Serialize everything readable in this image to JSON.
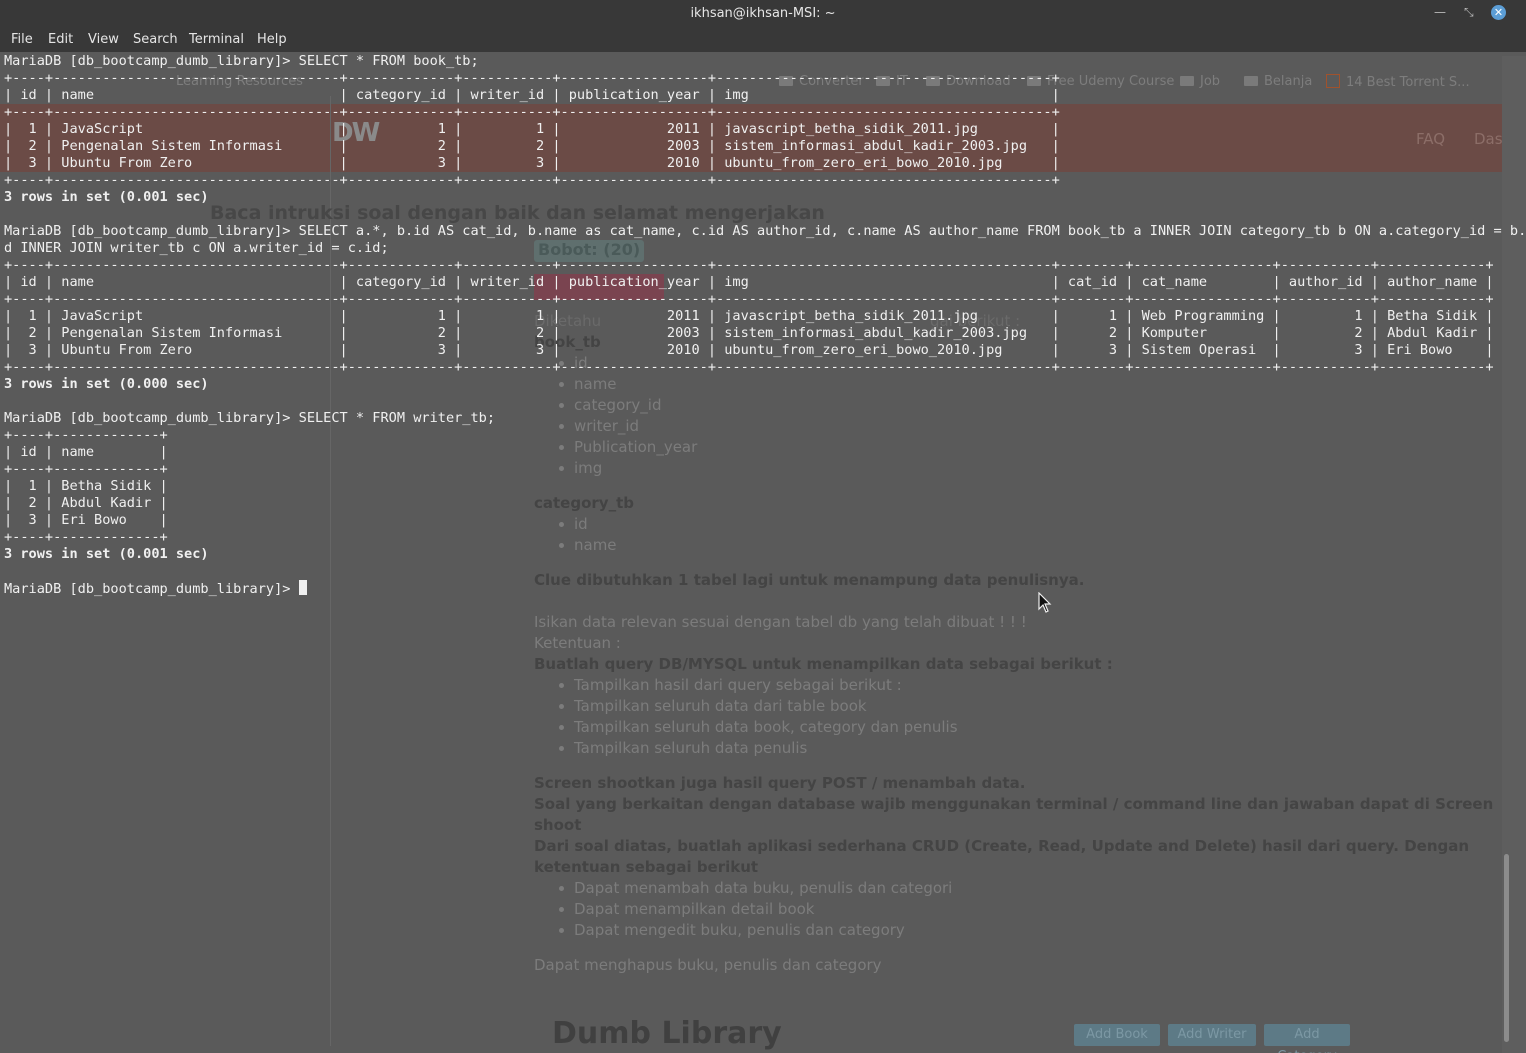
{
  "window": {
    "title": "ikhsan@ikhsan-MSI: ~"
  },
  "menu": [
    "File",
    "Edit",
    "View",
    "Search",
    "Terminal",
    "Help"
  ],
  "terminal": {
    "lines": [
      {
        "text": "MariaDB [db_bootcamp_dumb_library]> SELECT * FROM book_tb;",
        "bold": false
      },
      {
        "text": "+----+-----------------------------------+-------------+-----------+------------------+-----------------------------------------+",
        "bold": false
      },
      {
        "text": "| id | name                              | category_id | writer_id | publication_year | img                                     |",
        "bold": false
      },
      {
        "text": "+----+-----------------------------------+-------------+-----------+------------------+-----------------------------------------+",
        "bold": false
      },
      {
        "text": "|  1 | JavaScript                        |           1 |         1 |             2011 | javascript_betha_sidik_2011.jpg         |",
        "bold": false
      },
      {
        "text": "|  2 | Pengenalan Sistem Informasi       |           2 |         2 |             2003 | sistem_informasi_abdul_kadir_2003.jpg   |",
        "bold": false
      },
      {
        "text": "|  3 | Ubuntu From Zero                  |           3 |         3 |             2010 | ubuntu_from_zero_eri_bowo_2010.jpg      |",
        "bold": false
      },
      {
        "text": "+----+-----------------------------------+-------------+-----------+------------------+-----------------------------------------+",
        "bold": false
      },
      {
        "text": "3 rows in set (0.001 sec)",
        "bold": true
      },
      {
        "text": "",
        "bold": false
      },
      {
        "text": "MariaDB [db_bootcamp_dumb_library]> SELECT a.*, b.id AS cat_id, b.name as cat_name, c.id AS author_id, c.name AS author_name FROM book_tb a INNER JOIN category_tb b ON a.category_id = b.i",
        "bold": false
      },
      {
        "text": "d INNER JOIN writer_tb c ON a.writer_id = c.id;",
        "bold": false
      },
      {
        "text": "+----+-----------------------------------+-------------+-----------+------------------+-----------------------------------------+--------+-----------------+-----------+-------------+",
        "bold": false
      },
      {
        "text": "| id | name                              | category_id | writer_id | publication_year | img                                     | cat_id | cat_name        | author_id | author_name |",
        "bold": false
      },
      {
        "text": "+----+-----------------------------------+-------------+-----------+------------------+-----------------------------------------+--------+-----------------+-----------+-------------+",
        "bold": false
      },
      {
        "text": "|  1 | JavaScript                        |           1 |         1 |             2011 | javascript_betha_sidik_2011.jpg         |      1 | Web Programming |         1 | Betha Sidik |",
        "bold": false
      },
      {
        "text": "|  2 | Pengenalan Sistem Informasi       |           2 |         2 |             2003 | sistem_informasi_abdul_kadir_2003.jpg   |      2 | Komputer        |         2 | Abdul Kadir |",
        "bold": false
      },
      {
        "text": "|  3 | Ubuntu From Zero                  |           3 |         3 |             2010 | ubuntu_from_zero_eri_bowo_2010.jpg      |      3 | Sistem Operasi  |         3 | Eri Bowo    |",
        "bold": false
      },
      {
        "text": "+----+-----------------------------------+-------------+-----------+------------------+-----------------------------------------+--------+-----------------+-----------+-------------+",
        "bold": false
      },
      {
        "text": "3 rows in set (0.000 sec)",
        "bold": true
      },
      {
        "text": "",
        "bold": false
      },
      {
        "text": "MariaDB [db_bootcamp_dumb_library]> SELECT * FROM writer_tb;",
        "bold": false
      },
      {
        "text": "+----+-------------+",
        "bold": false
      },
      {
        "text": "| id | name        |",
        "bold": false
      },
      {
        "text": "+----+-------------+",
        "bold": false
      },
      {
        "text": "|  1 | Betha Sidik |",
        "bold": false
      },
      {
        "text": "|  2 | Abdul Kadir |",
        "bold": false
      },
      {
        "text": "|  3 | Eri Bowo    |",
        "bold": false
      },
      {
        "text": "+----+-------------+",
        "bold": false
      },
      {
        "text": "3 rows in set (0.001 sec)",
        "bold": true
      },
      {
        "text": "",
        "bold": false
      }
    ],
    "prompt": "MariaDB [db_bootcamp_dumb_library]> "
  },
  "background_page": {
    "bookmarks": [
      {
        "label": "Learning Resources",
        "icon": "folder-icon"
      },
      {
        "label": "Converter",
        "icon": "folder-icon"
      },
      {
        "label": "IT",
        "icon": "folder-icon"
      },
      {
        "label": "Download",
        "icon": "folder-icon"
      },
      {
        "label": "Free Udemy Course",
        "icon": "folder-icon"
      },
      {
        "label": "Job",
        "icon": "folder-icon"
      },
      {
        "label": "Belanja",
        "icon": "folder-icon"
      },
      {
        "label": "14 Best Torrent S...",
        "icon": "torrent-icon"
      }
    ],
    "nav": [
      "FAQ",
      "Das"
    ],
    "instruction_heading": "Baca intruksi soal dengan baik dan selamat mengerjakan",
    "bobot": "Bobot: (20)",
    "book_tb_title": "book_tb",
    "book_tb_fields": [
      "id",
      "name",
      "category_id",
      "writer_id",
      "Publication_year",
      "img"
    ],
    "diketahui_tail": "gai berikut :",
    "category_tb_title": "category_tb",
    "category_tb_fields": [
      "id",
      "name"
    ],
    "clue": "Clue dibutuhkan 1 tabel lagi untuk menampung data penulisnya.",
    "isikan": "Isikan data relevan sesuai dengan tabel db yang telah dibuat ! ! !",
    "ketentuan": "Ketentuan :",
    "buatlah": "Buatlah query DB/MYSQL untuk menampilkan data sebagai berikut :",
    "query_items": [
      "Tampilkan hasil dari query sebagai berikut :",
      "Tampilkan seluruh data dari table book",
      "Tampilkan seluruh data book, category dan penulis",
      "Tampilkan seluruh data penulis"
    ],
    "screenshoot_note": "Screen shootkan juga hasil query POST / menambah data.",
    "soal_line1": "Soal yang berkaitan dengan database wajib menggunakan terminal / command line dan jawaban dapat di Screen",
    "soal_line2": "shoot",
    "crud_line1": "Dari soal diatas, buatlah aplikasi sederhana CRUD (Create, Read, Update and Delete) hasil dari query. Dengan",
    "crud_line2": "ketentuan sebagai berikut",
    "crud_items": [
      "Dapat menambah data buku, penulis dan categori",
      "Dapat menampilkan detail book",
      "Dapat mengedit buku, penulis dan category"
    ],
    "hapus": "Dapat menghapus buku, penulis dan category",
    "app_title": "Dumb Library",
    "buttons": [
      "Add Book",
      "Add Writer",
      "Add Category"
    ]
  },
  "colors": {
    "terminal_text": "#f0f0f0",
    "titlebar": "#383838",
    "header_band": "#6b4b46",
    "close_button": "#5c9ed6"
  }
}
